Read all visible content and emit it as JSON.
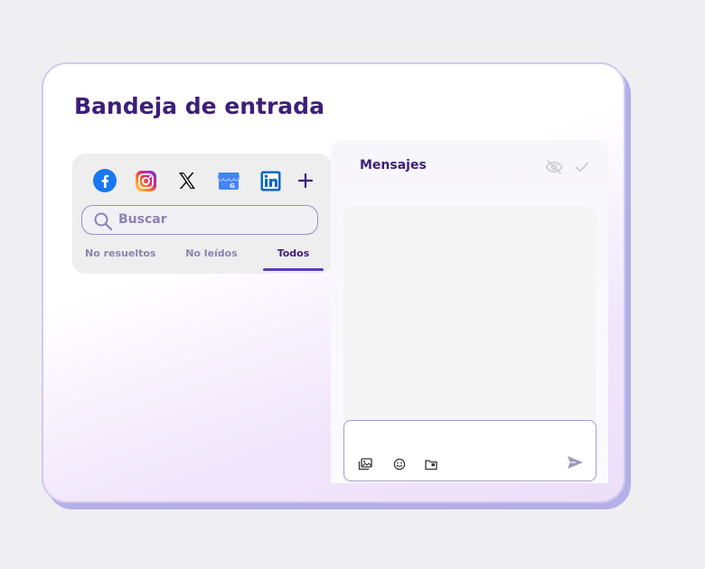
{
  "inbox": {
    "title": "Bandeja de entrada"
  },
  "channels": [
    {
      "name": "facebook-icon",
      "color": "#1877f2"
    },
    {
      "name": "instagram-icon",
      "color": "#e1306c"
    },
    {
      "name": "x-icon",
      "color": "#111111"
    },
    {
      "name": "google-business-icon",
      "color": "#4285f4"
    },
    {
      "name": "linkedin-icon",
      "color": "#0a66c2"
    },
    {
      "name": "add-channel-icon",
      "color": "#3c1f78"
    }
  ],
  "search": {
    "placeholder": "Buscar",
    "value": ""
  },
  "tabs": [
    {
      "label": "No resueltos",
      "active": false
    },
    {
      "label": "No leídos",
      "active": false
    },
    {
      "label": "Todos",
      "active": true
    }
  ],
  "messages": {
    "title": "Mensajes"
  },
  "composer": {
    "icons": [
      "gallery-icon",
      "emoji-icon",
      "folder-icon"
    ],
    "send_icon": "send-icon"
  },
  "colors": {
    "brand": "#3c1f78",
    "accent": "#5b3ec2",
    "border": "#a69cd4"
  }
}
